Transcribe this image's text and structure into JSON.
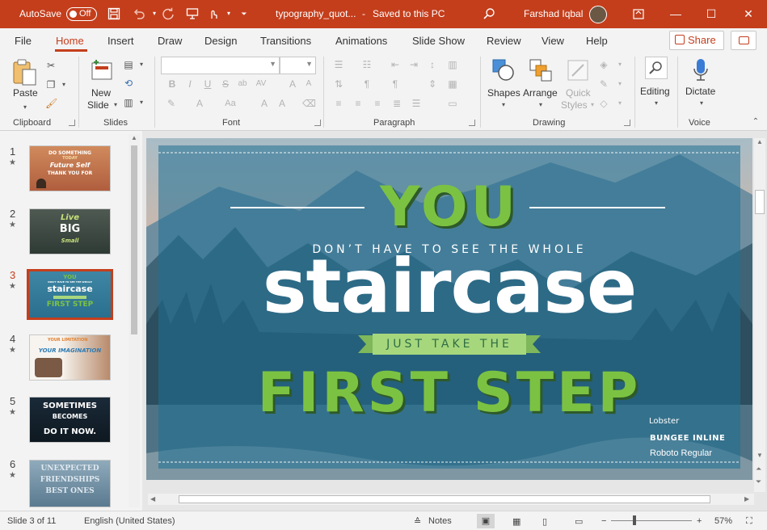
{
  "titlebar": {
    "autosave_label": "AutoSave",
    "autosave_state": "Off",
    "filename": "typography_quot...",
    "save_status": "Saved to this PC",
    "user_name": "Farshad Iqbal",
    "accent_color": "#c43e1c"
  },
  "tabs": [
    {
      "label": "File"
    },
    {
      "label": "Home"
    },
    {
      "label": "Insert"
    },
    {
      "label": "Draw"
    },
    {
      "label": "Design"
    },
    {
      "label": "Transitions"
    },
    {
      "label": "Animations"
    },
    {
      "label": "Slide Show"
    },
    {
      "label": "Review"
    },
    {
      "label": "View"
    },
    {
      "label": "Help"
    }
  ],
  "share_label": "Share",
  "ribbon": {
    "clipboard": {
      "paste": "Paste",
      "group": "Clipboard"
    },
    "slides": {
      "new_slide_1": "New",
      "new_slide_2": "Slide",
      "group": "Slides"
    },
    "font": {
      "group": "Font",
      "bold": "B",
      "italic": "I",
      "underline": "U",
      "strike": "S",
      "charspacing": "AV",
      "case": "Aa"
    },
    "paragraph": {
      "group": "Paragraph"
    },
    "drawing": {
      "shapes": "Shapes",
      "arrange": "Arrange",
      "quick1": "Quick",
      "quick2": "Styles",
      "group": "Drawing"
    },
    "editing": {
      "label": "Editing"
    },
    "voice": {
      "dictate": "Dictate",
      "group": "Voice"
    }
  },
  "thumbnails": [
    {
      "num": "1",
      "lines": [
        "DO SOMETHING",
        "TODAY",
        "Future Self",
        "THANK YOU FOR"
      ]
    },
    {
      "num": "2",
      "lines": [
        "Live",
        "BIG",
        "Small"
      ]
    },
    {
      "num": "3",
      "lines": [
        "YOU",
        "DON'T HAVE TO SEE THE WHOLE",
        "staircase",
        "FIRST STEP"
      ]
    },
    {
      "num": "4",
      "lines": [
        "YOUR LIMITATION",
        "YOUR IMAGINATION"
      ]
    },
    {
      "num": "5",
      "lines": [
        "SOMETIMES",
        "BECOMES",
        "DO IT NOW."
      ]
    },
    {
      "num": "6",
      "lines": [
        "UNEXPECTED",
        "FRIENDSHIPS",
        "BEST ONES"
      ]
    }
  ],
  "slide": {
    "line1": "YOU",
    "line2": "DON’T HAVE TO SEE THE WHOLE",
    "line3": "staircase",
    "line4": "JUST TAKE THE",
    "line5": "FIRST STEP",
    "font_note_1": "Lobster",
    "font_note_2": "BUNGEE INLINE",
    "font_note_3": "Roboto Regular",
    "green": "#7cc242",
    "ribbon_green": "#a6d77d",
    "overlay_blue": "#1f6f94"
  },
  "status": {
    "slide_counter": "Slide 3 of 11",
    "language": "English (United States)",
    "notes_label": "Notes",
    "zoom": "57%"
  }
}
